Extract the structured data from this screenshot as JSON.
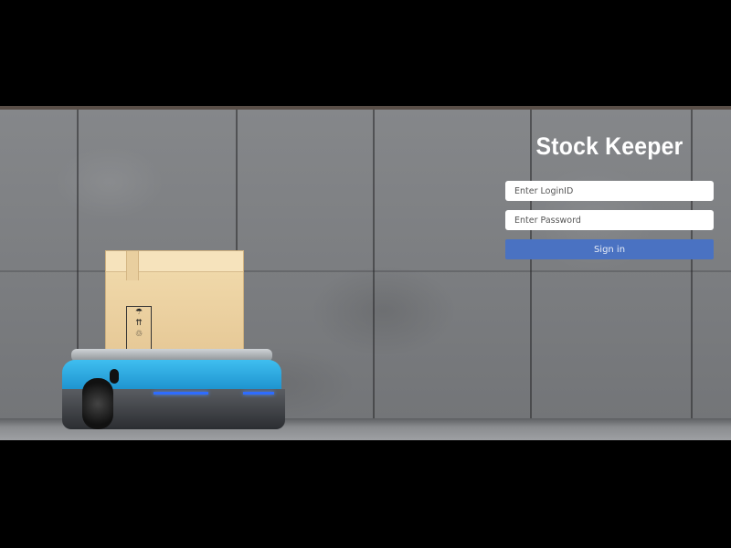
{
  "app": {
    "title": "Stock Keeper"
  },
  "login": {
    "loginid_placeholder": "Enter LoginID",
    "loginid_value": "",
    "password_placeholder": "Enter Password",
    "password_value": "",
    "signin_label": "Sign in"
  },
  "colors": {
    "accent": "#4a72c2",
    "letterbox": "#000000",
    "wall": "#7b7d80"
  }
}
